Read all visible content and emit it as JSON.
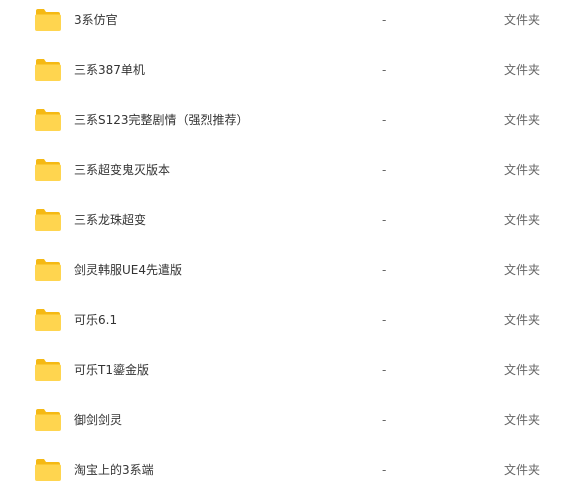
{
  "colors": {
    "folder_back": "#F5B914",
    "folder_front": "#FFD54F",
    "text_primary": "#333333",
    "text_secondary": "#666666"
  },
  "files": [
    {
      "name": "3系仿官",
      "size": "-",
      "type": "文件夹",
      "icon": "folder-icon"
    },
    {
      "name": "三系387单机",
      "size": "-",
      "type": "文件夹",
      "icon": "folder-icon"
    },
    {
      "name": "三系S123完整剧情（强烈推荐）",
      "size": "-",
      "type": "文件夹",
      "icon": "folder-icon"
    },
    {
      "name": "三系超变鬼灭版本",
      "size": "-",
      "type": "文件夹",
      "icon": "folder-icon"
    },
    {
      "name": "三系龙珠超变",
      "size": "-",
      "type": "文件夹",
      "icon": "folder-icon"
    },
    {
      "name": "剑灵韩服UE4先遣版",
      "size": "-",
      "type": "文件夹",
      "icon": "folder-icon"
    },
    {
      "name": "可乐6.1",
      "size": "-",
      "type": "文件夹",
      "icon": "folder-icon"
    },
    {
      "name": "可乐T1鎏金版",
      "size": "-",
      "type": "文件夹",
      "icon": "folder-icon"
    },
    {
      "name": "御剑剑灵",
      "size": "-",
      "type": "文件夹",
      "icon": "folder-icon"
    },
    {
      "name": "淘宝上的3系端",
      "size": "-",
      "type": "文件夹",
      "icon": "folder-icon"
    }
  ]
}
